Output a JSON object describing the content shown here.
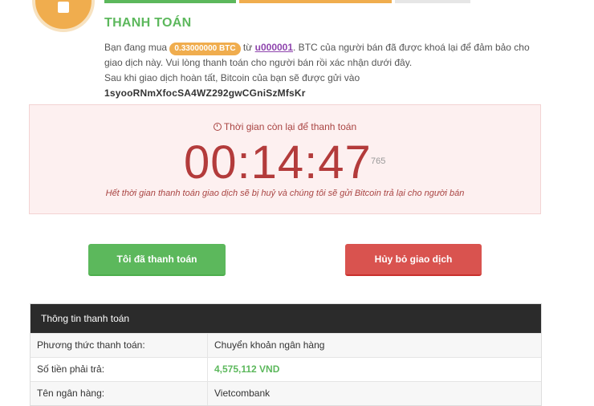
{
  "header": {
    "title": "THANH TOÁN"
  },
  "description": {
    "text1": "Bạn đang mua",
    "amount_badge": "0.33000000 BTC",
    "text2": "từ",
    "seller": "u000001",
    "text3": ". BTC của người bán đã được khoá lại để đảm bảo cho giao dịch này. Vui lòng thanh toán cho người bán rồi xác nhận dưới đây.",
    "text4": "Sau khi giao dịch hoàn tất, Bitcoin của bạn sẽ được gửi vào",
    "address": "1syooRNmXfocSA4WZ292gwCGniSzMfsKr"
  },
  "timer": {
    "label": "Thời gian còn lại để thanh toán",
    "time": "00:14:47",
    "ms": "765",
    "note": "Hết thời gian thanh toán giao dịch sẽ bị huỷ và chúng tôi sẽ gửi Bitcoin trả lại cho người bán"
  },
  "buttons": {
    "paid": "Tôi đã thanh toán",
    "cancel": "Hủy bỏ giao dịch"
  },
  "payment_info": {
    "title": "Thông tin thanh toán",
    "rows": [
      {
        "label": "Phương thức thanh toán:",
        "value": "Chuyển khoản ngân hàng"
      },
      {
        "label": "Số tiền phải trả:",
        "value": "4,575,112 VND"
      },
      {
        "label": "Tên ngân hàng:",
        "value": "Vietcombank"
      }
    ]
  },
  "colors": {
    "green": "#5cb85c",
    "orange": "#f0ad4e",
    "red": "#d9534f"
  }
}
